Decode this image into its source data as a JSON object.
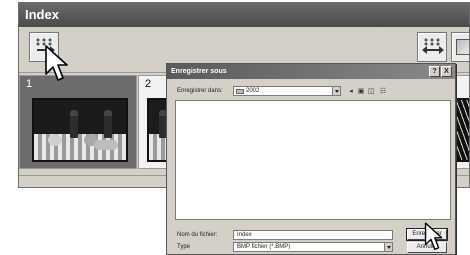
{
  "index_window": {
    "title": "Index",
    "thumbnails": [
      {
        "number": "1",
        "selected": true
      },
      {
        "number": "2",
        "selected": false
      },
      {
        "number": "",
        "selected": false
      }
    ]
  },
  "save_dialog": {
    "title": "Enregistrer sous",
    "look_in_label": "Enregistrer dans:",
    "look_in_value": "2002",
    "help_symbol": "?",
    "close_symbol": "X",
    "filename_label": "Nom du fichier:",
    "filename_value": "Index",
    "type_label": "Type",
    "type_value": "BMP fichier (*.BMP)",
    "save_button": "Enregistrer",
    "cancel_button": "Annuler"
  },
  "icons": {
    "index_toolbar": [
      "save-index-icon",
      "arrange-icon",
      "view-icon"
    ],
    "dialog_nav": [
      "back-icon",
      "up-folder-icon",
      "new-folder-icon",
      "views-menu-icon"
    ],
    "cursors": [
      "mouse-pointer-icon",
      "mouse-pointer-icon"
    ]
  },
  "colors": {
    "title_bar": "#4b4b4b",
    "selected_thumb": "#6c6c6c",
    "window_face": "#d4d0c8"
  }
}
